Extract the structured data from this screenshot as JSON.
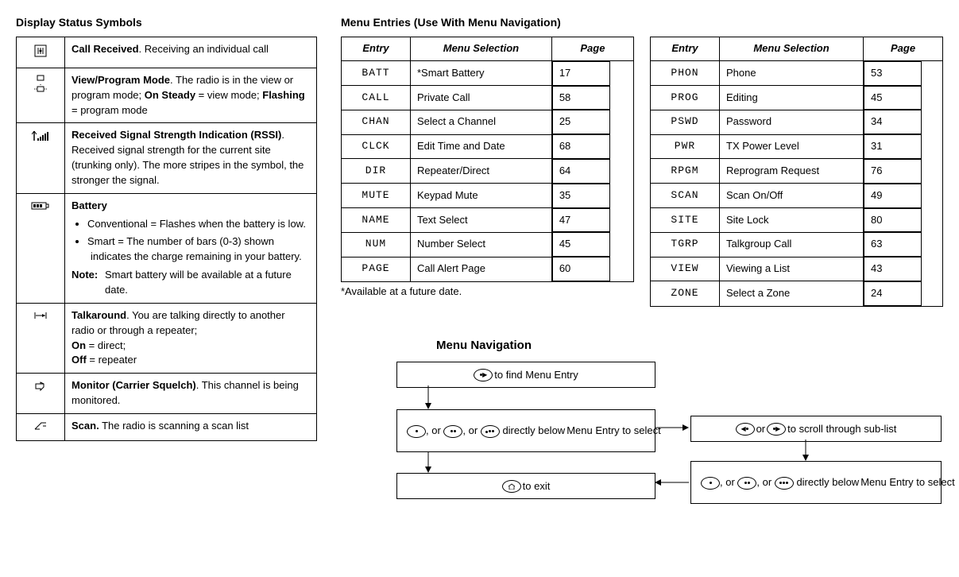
{
  "headings": {
    "display_status": "Display Status Symbols",
    "menu_entries": "Menu Entries (Use With Menu Navigation)",
    "menu_navigation": "Menu Navigation"
  },
  "status_symbols": [
    {
      "icon": "call-received-icon",
      "title": "Call Received",
      "desc": ". Receiving an individual call"
    },
    {
      "icon": "view-program-icon",
      "title": "View/Program Mode",
      "desc_parts": [
        ". The radio is in the view or program mode; ",
        "On Steady",
        " = view mode; ",
        "Flashing",
        " = program mode"
      ]
    },
    {
      "icon": "rssi-icon",
      "title": "Received Signal Strength Indication (RSSI)",
      "desc": ". Received signal strength for the current site (trunking only). The more stripes in the symbol, the stronger the signal."
    },
    {
      "icon": "battery-icon",
      "title": "Battery",
      "bullets": [
        "Conventional = Flashes when the battery is low.",
        "Smart = The number of bars (0-3) shown indicates the charge remaining in your battery."
      ],
      "note_label": "Note:",
      "note_text": "Smart battery will be available at a future date."
    },
    {
      "icon": "talkaround-icon",
      "title": "Talkaround",
      "desc_parts": [
        ". You are talking directly to another radio or through a repeater;",
        "On",
        " = direct;",
        "Off",
        " = repeater"
      ]
    },
    {
      "icon": "monitor-icon",
      "title": "Monitor (Carrier Squelch)",
      "desc": ". This channel is being monitored."
    },
    {
      "icon": "scan-icon",
      "title": "Scan.",
      "desc": " The radio is scanning a scan list"
    }
  ],
  "menu_headers": {
    "entry": "Entry",
    "selection": "Menu Selection",
    "page": "Page"
  },
  "menu_left": [
    {
      "entry": "BATT",
      "selection": "*Smart Battery",
      "page": "17"
    },
    {
      "entry": "CALL",
      "selection": "Private Call",
      "page": "58"
    },
    {
      "entry": "CHAN",
      "selection": "Select a Channel",
      "page": "25"
    },
    {
      "entry": "CLCK",
      "selection": "Edit Time and Date",
      "page": "68"
    },
    {
      "entry": "DIR",
      "selection": "Repeater/Direct",
      "page": "64"
    },
    {
      "entry": "MUTE",
      "selection": "Keypad Mute",
      "page": "35"
    },
    {
      "entry": "NAME",
      "selection": "Text Select",
      "page": "47"
    },
    {
      "entry": "NUM",
      "selection": "Number Select",
      "page": "45"
    },
    {
      "entry": "PAGE",
      "selection": "Call Alert Page",
      "page": "60"
    }
  ],
  "menu_right": [
    {
      "entry": "PHON",
      "selection": "Phone",
      "page": "53"
    },
    {
      "entry": "PROG",
      "selection": "Editing",
      "page": "45"
    },
    {
      "entry": "PSWD",
      "selection": "Password",
      "page": "34"
    },
    {
      "entry": "PWR",
      "selection": "TX Power Level",
      "page": "31"
    },
    {
      "entry": "RPGM",
      "selection": "Reprogram Request",
      "page": "76"
    },
    {
      "entry": "SCAN",
      "selection": "Scan On/Off",
      "page": "49"
    },
    {
      "entry": "SITE",
      "selection": "Site Lock",
      "page": "80"
    },
    {
      "entry": "TGRP",
      "selection": "Talkgroup Call",
      "page": "63"
    },
    {
      "entry": "VIEW",
      "selection": "Viewing a List",
      "page": "43"
    },
    {
      "entry": "ZONE",
      "selection": "Select a Zone",
      "page": "24"
    }
  ],
  "footnote": "*Available at a future date.",
  "nav": {
    "find": " to find Menu Entry",
    "select_line1": " directly below",
    "select_line2": "Menu Entry to select",
    "scroll": " to scroll through sub-list",
    "exit": "  to exit",
    "or": " or ",
    "comma_or": ", or "
  }
}
